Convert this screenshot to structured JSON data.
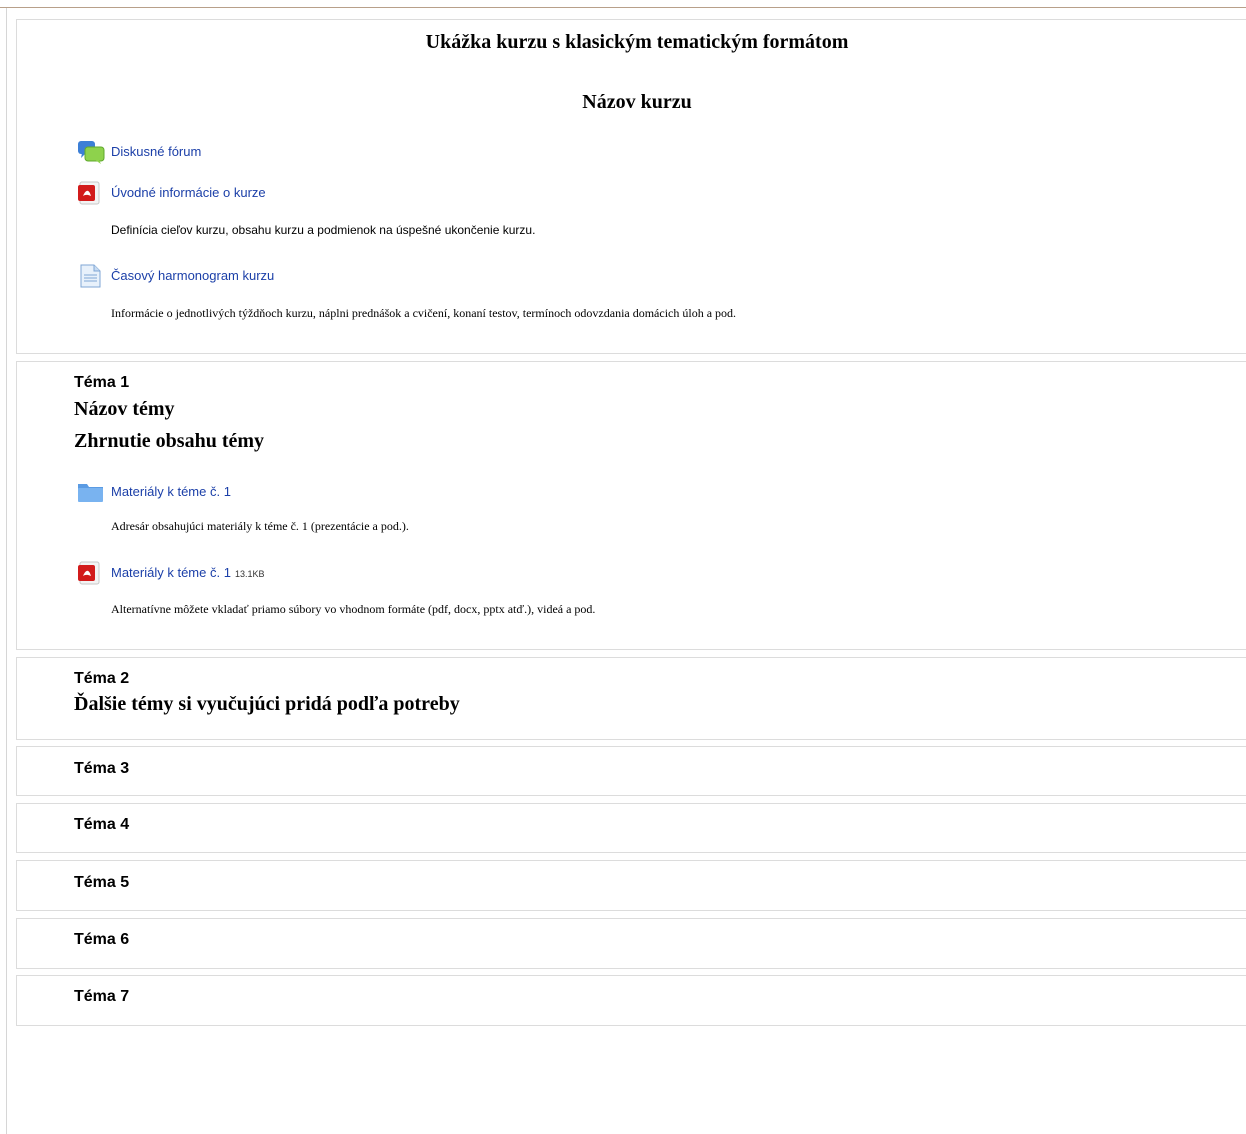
{
  "course": {
    "header_section": {
      "title": "Ukážka kurzu s klasickým tematickým formátom",
      "subtitle": "Názov kurzu",
      "activities": [
        {
          "icon": "forum-icon",
          "label": "Diskusné fórum"
        },
        {
          "icon": "pdf-icon",
          "label": "Úvodné informácie o kurze",
          "description": "Definícia cieľov kurzu, obsahu kurzu a podmienok na úspešné ukončenie kurzu."
        },
        {
          "icon": "document-icon",
          "label": "Časový harmonogram kurzu",
          "description": "Informácie o jednotlivých týždňoch kurzu, náplni prednášok a cvičení, konaní testov, termínoch odovzdania domácich úloh a pod."
        }
      ]
    },
    "topics": [
      {
        "label": "Téma 1",
        "name": "Názov témy",
        "summary": "Zhrnutie obsahu témy",
        "activities": [
          {
            "icon": "folder-icon",
            "label": "Materiály k téme č. 1",
            "description": "Adresár obsahujúci materiály k téme č. 1 (prezentácie a pod.)."
          },
          {
            "icon": "pdf-icon",
            "label": "Materiály k téme č. 1",
            "size": "13.1KB",
            "description": "Alternatívne môžete vkladať priamo súbory vo vhodnom formáte (pdf, docx, pptx atď.), videá a pod."
          }
        ]
      },
      {
        "label": "Téma 2",
        "name": "Ďalšie témy si vyučujúci pridá podľa potreby"
      },
      {
        "label": "Téma 3"
      },
      {
        "label": "Téma 4"
      },
      {
        "label": "Téma 5"
      },
      {
        "label": "Téma 6"
      },
      {
        "label": "Téma 7"
      }
    ]
  },
  "colors": {
    "link": "#1b3fa8",
    "border": "#dcdcdc"
  }
}
